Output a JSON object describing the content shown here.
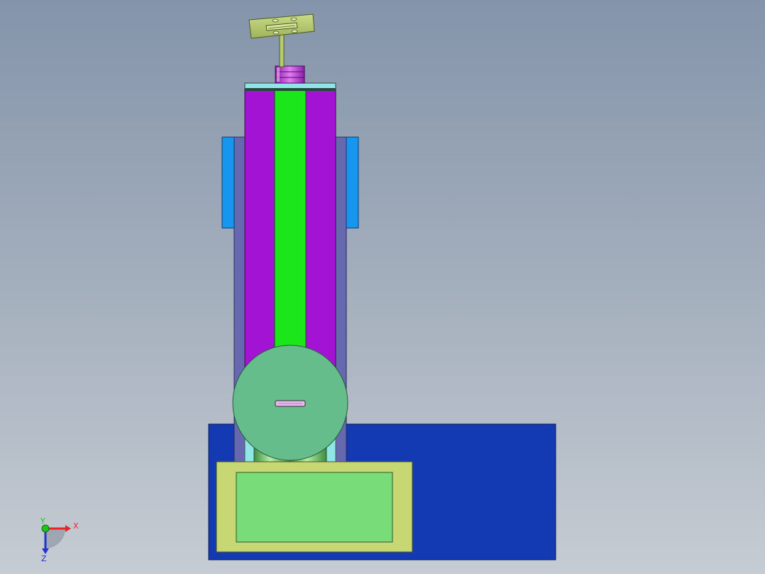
{
  "view": {
    "background_top": "#8494aa",
    "background_bottom": "#c6ccd3"
  },
  "model": {
    "parts": [
      "base-plate",
      "bracket",
      "gearbox",
      "motor-housing",
      "column-housing",
      "column-body",
      "lead-screw",
      "side-guides",
      "top-cap",
      "nut-assembly",
      "handwheel"
    ],
    "colors": {
      "base_plate": "#133ab2",
      "bracket": "#c7d773",
      "gearbox": "#78dc78",
      "motor_housing": "#66bd8c",
      "column_housing": "#6669b0",
      "column_body": "#a313d3",
      "lead_screw": "#1ae61a",
      "side_guide": "#1796ee",
      "top_cap": "#90e6e6",
      "nut": "#c63ee0",
      "handwheel": "#b6cc70"
    }
  },
  "triad": {
    "icon": "coordinate-triad-icon",
    "x_label": "X",
    "y_label": "Y",
    "z_label": "Z",
    "x_color": "#e6262a",
    "y_color": "#1cc41c",
    "z_color": "#2233cc"
  }
}
